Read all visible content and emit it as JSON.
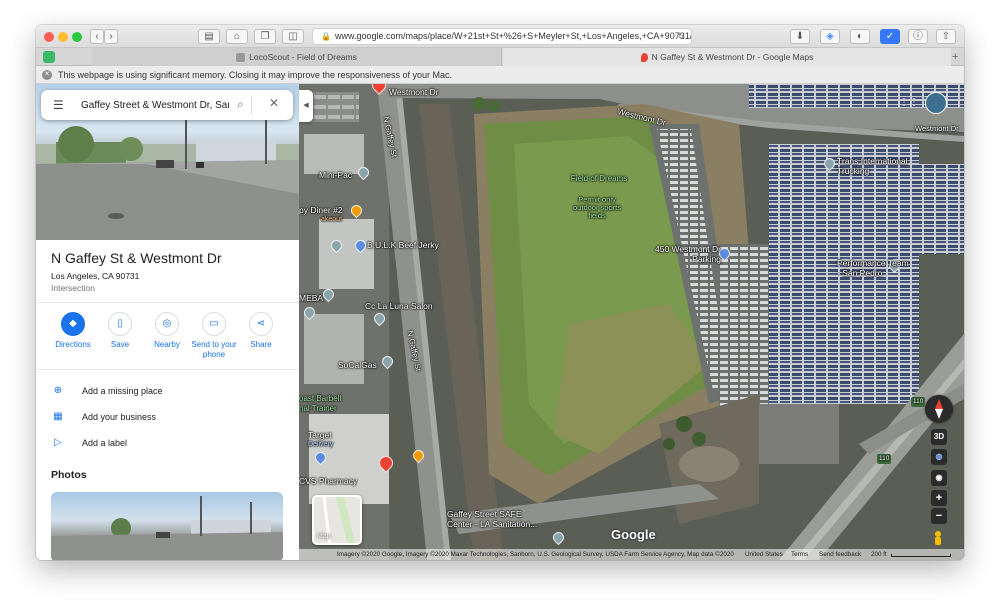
{
  "browser": {
    "url": "www.google.com/maps/place/W+21st+St+%26+S+Meyler+St,+Los+Angeles,+CA+90731/@",
    "tabs": [
      {
        "label": "LocoScout - Field of Dreams"
      },
      {
        "label": "N Gaffey St & Westmont Dr - Google Maps"
      }
    ],
    "notice": "This webpage is using significant memory. Closing it may improve the responsiveness of your Mac."
  },
  "search": {
    "value": "Gaffey Street & Westmont Dr, San"
  },
  "place": {
    "title": "N Gaffey St & Westmont Dr",
    "address": "Los Angeles, CA 90731",
    "type": "Intersection"
  },
  "actions": [
    {
      "label": "Directions",
      "icon": "directions-icon"
    },
    {
      "label": "Save",
      "icon": "bookmark-icon"
    },
    {
      "label": "Nearby",
      "icon": "nearby-icon"
    },
    {
      "label": "Send to your phone",
      "icon": "send-to-phone-icon"
    },
    {
      "label": "Share",
      "icon": "share-icon"
    }
  ],
  "options": [
    {
      "label": "Add a missing place",
      "icon": "add-place-icon"
    },
    {
      "label": "Add your business",
      "icon": "add-business-icon"
    },
    {
      "label": "Add a label",
      "icon": "label-icon"
    }
  ],
  "photos_title": "Photos",
  "map": {
    "labels": {
      "westmont_top": "Westmont Dr",
      "westmont_diag": "Westmont Dr",
      "westmont_right": "Westmont Dr",
      "gaffey_top": "N Gaffey St",
      "gaffey_mid": "N Gaffey St",
      "field": "Field of Dreams",
      "field_sub": "Permit only outdoor sports fields",
      "parking": "450 Westmont Dr Parking",
      "trans": "Trans International Trucking",
      "performance": "Performance Team - San Pedro",
      "minipac": "Mini-Pac",
      "diner": "py Diner #2",
      "diner_sub": "akeout",
      "bulk": "B.U.L.K Beef Jerky",
      "salon": "Cc La Luna Salon",
      "meba": "MEBA",
      "socalgas": "SoCalGas",
      "barbell": "oast Barbell",
      "barbell_sub": "nal Trainer",
      "target": "Target",
      "target_sub": "Delivery",
      "cvs": "CVS Pharmacy",
      "gaffey_center": "Gaffey Street SAFE Center - LA Sanitation...",
      "route110a": "110",
      "route110b": "110",
      "minimap": "Map"
    },
    "controls": {
      "three_d": "3D"
    },
    "attribution": {
      "imagery": "Imagery ©2020 Google, Imagery ©2020 Maxar Technologies, Sanborn, U.S. Geological Survey, USDA Farm Service Agency, Map data ©2020",
      "country": "United States",
      "terms": "Terms",
      "feedback": "Send feedback",
      "scale": "200 ft"
    },
    "logo": "Google"
  }
}
